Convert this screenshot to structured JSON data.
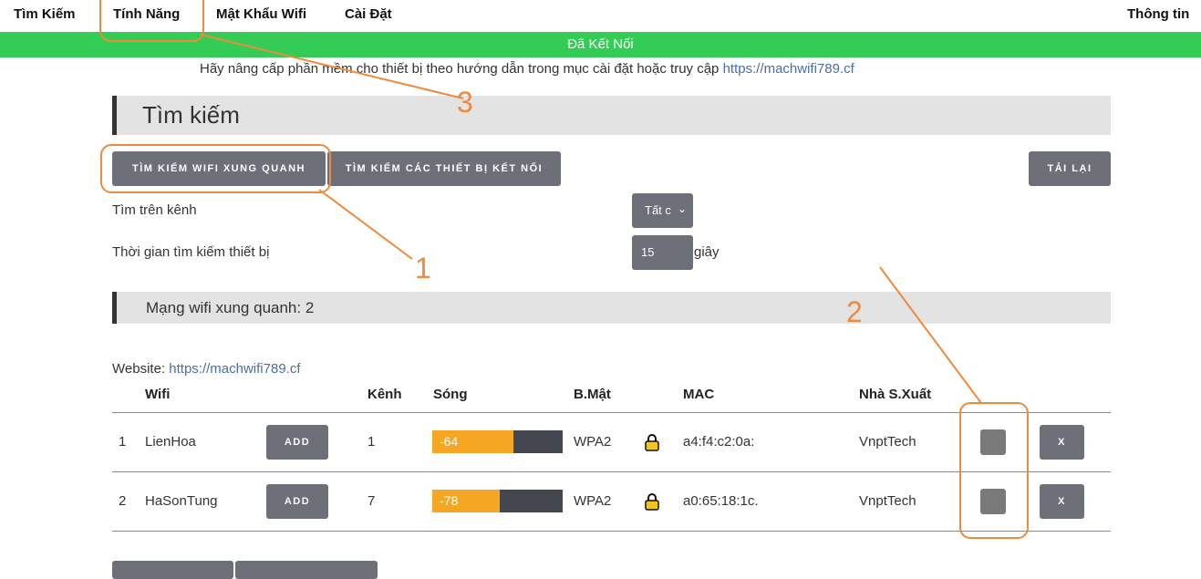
{
  "nav": {
    "items": [
      "Tìm Kiếm",
      "Tính Năng",
      "Mật Khẩu Wifi",
      "Cài Đặt"
    ],
    "right": "Thông tin"
  },
  "status": "Đã Kết Nối",
  "notice": {
    "text": "Hãy nâng cấp phần mềm cho thiết bị theo hướng dẫn trong mục cài đặt hoặc truy cập",
    "link": "https://machwifi789.cf"
  },
  "search": {
    "title": "Tìm kiếm",
    "btn_scan_wifi": "TÌM KIẾM WIFI XUNG QUANH",
    "btn_scan_devices": "TÌM KIẾM CÁC THIẾT BỊ KẾT NỐI",
    "btn_reload": "TẢI LẠI",
    "channel_label": "Tìm trên kênh",
    "channel_value": "Tất c",
    "time_label": "Thời gian tìm kiếm thiết bị",
    "time_value": "15",
    "time_unit": "giây"
  },
  "networks": {
    "title": "Mạng wifi xung quanh: 2",
    "website_label": "Website:",
    "website_link": "https://machwifi789.cf",
    "headers": [
      "Wifi",
      "Kênh",
      "Sóng",
      "B.Mật",
      "MAC",
      "Nhà S.Xuất"
    ],
    "rows": [
      {
        "index": "1",
        "ssid": "LienHoa",
        "add": "ADD",
        "channel": "1",
        "signal": "-64",
        "signal_fraction": 0.62,
        "security": "WPA2",
        "mac": "a4:f4:c2:0a:",
        "vendor": "VnptTech",
        "remove": "X"
      },
      {
        "index": "2",
        "ssid": "HaSonTung",
        "add": "ADD",
        "channel": "7",
        "signal": "-78",
        "signal_fraction": 0.52,
        "security": "WPA2",
        "mac": "a0:65:18:1c.",
        "vendor": "VnptTech",
        "remove": "X"
      }
    ]
  },
  "annotations": [
    "1",
    "2",
    "3"
  ],
  "colors": {
    "status_green": "#33cc55",
    "button_gray": "#6e7079",
    "signal_orange": "#f5a623",
    "annotation_orange": "#ef8a3c",
    "link_blue": "#4a6fa5"
  }
}
